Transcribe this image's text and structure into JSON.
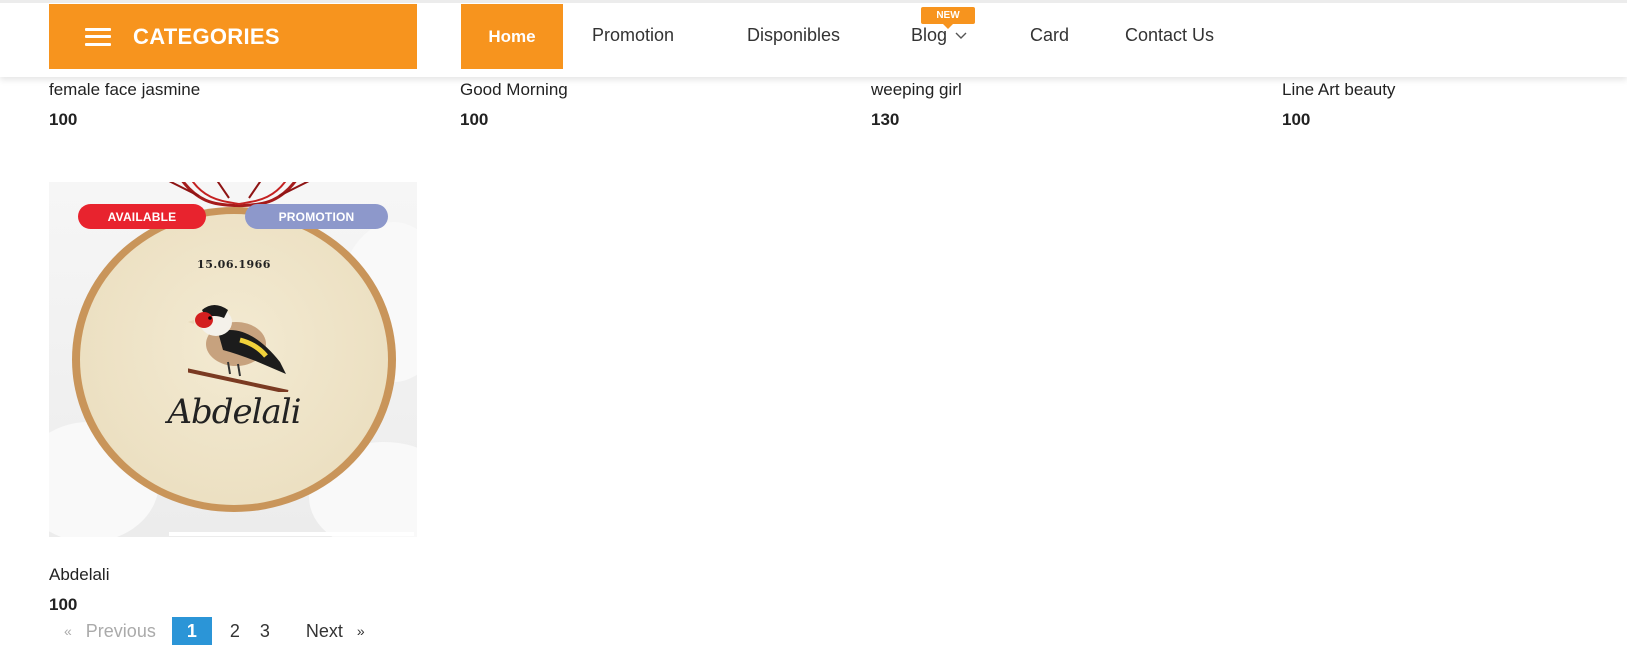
{
  "header": {
    "categories_label": "CATEGORIES",
    "nav": {
      "home": "Home",
      "promotion": "Promotion",
      "disponibles": "Disponibles",
      "blog": "Blog",
      "blog_badge": "NEW",
      "card": "Card",
      "contact": "Contact Us"
    }
  },
  "products": [
    {
      "name": "female face jasmine",
      "price": "100"
    },
    {
      "name": "Good Morning",
      "price": "100"
    },
    {
      "name": "weeping girl",
      "price": "130"
    },
    {
      "name": "Line Art beauty",
      "price": "100"
    },
    {
      "name": "Abdelali",
      "price": "100",
      "badges": [
        "AVAILABLE",
        "PROMOTION"
      ],
      "image_text": {
        "date": "15.06.1966",
        "name": "Abdelali"
      }
    }
  ],
  "pagination": {
    "previous": "Previous",
    "pages": [
      "1",
      "2",
      "3"
    ],
    "current": "1",
    "next": "Next"
  },
  "colors": {
    "accent": "#f7941e",
    "available": "#e8232e",
    "promotion": "#8d98cb",
    "page_active": "#2b95d7"
  }
}
